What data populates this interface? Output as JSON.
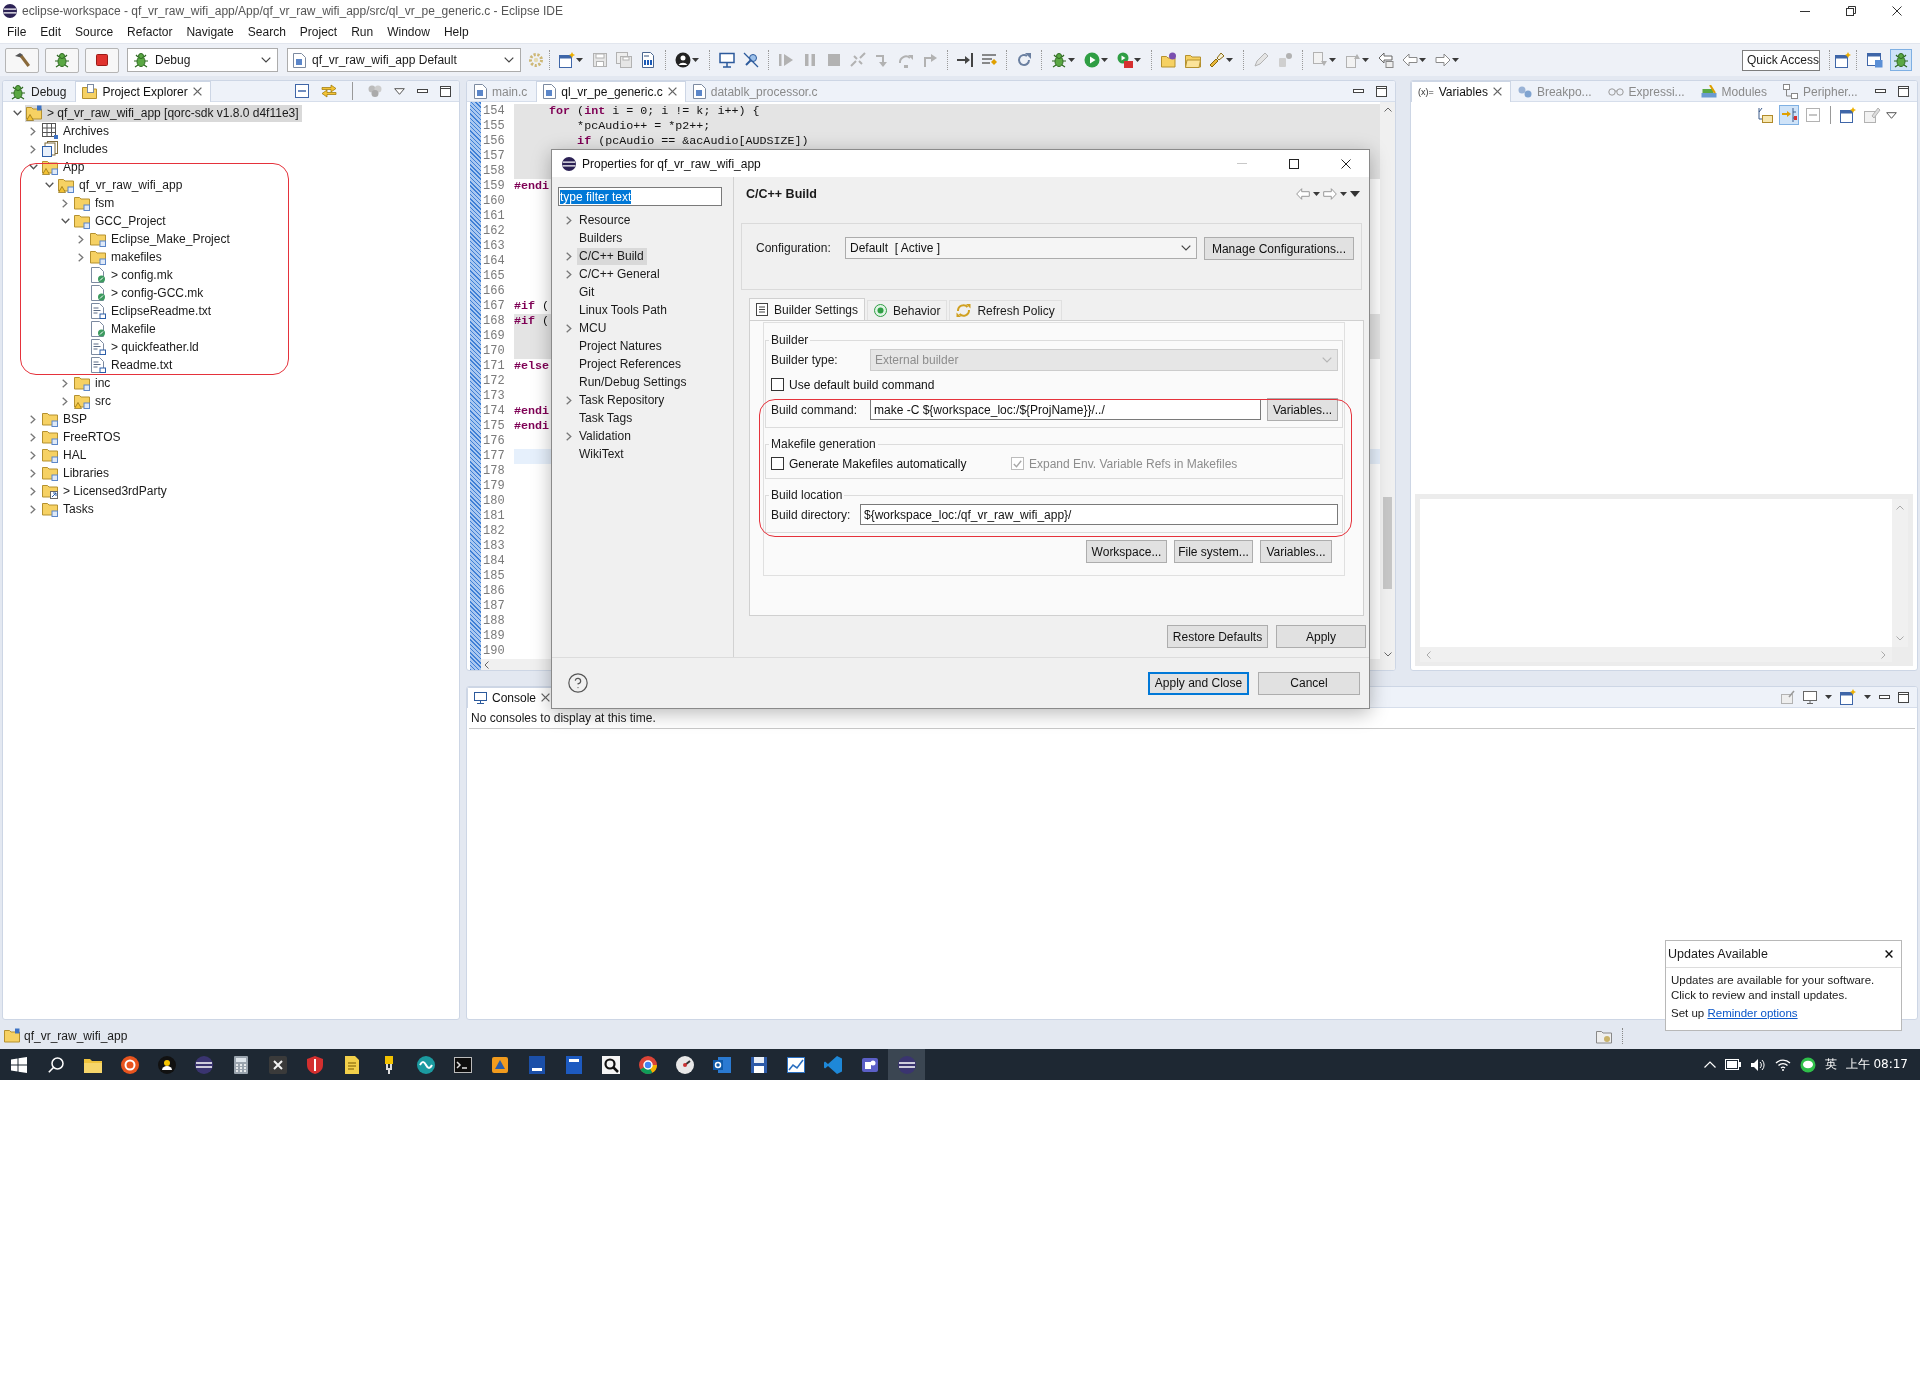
{
  "window": {
    "title": "eclipse-workspace - qf_vr_raw_wifi_app/App/qf_vr_raw_wifi_app/src/ql_vr_pe_generic.c - Eclipse IDE"
  },
  "menu": [
    "File",
    "Edit",
    "Source",
    "Refactor",
    "Navigate",
    "Search",
    "Project",
    "Run",
    "Window",
    "Help"
  ],
  "toolbar": {
    "launch_mode": "Debug",
    "launch_configuration": "qf_vr_raw_wifi_app Default",
    "quick_access": {
      "placeholder": "Quick Access"
    },
    "perspectives": [
      {
        "selected": false
      },
      {
        "selected": true
      }
    ]
  },
  "project_explorer": {
    "tabs": [
      {
        "label": "Debug",
        "selected": false
      },
      {
        "label": "Project Explorer",
        "selected": true
      }
    ],
    "tree": [
      {
        "label": "> qf_vr_raw_wifi_app [qorc-sdk v1.8.0 d4f11e3]",
        "kind": "project",
        "expanded": true,
        "selected": true,
        "children": [
          {
            "label": "Archives",
            "kind": "archives",
            "expanded": false,
            "selected": false
          },
          {
            "label": "Includes",
            "kind": "includes",
            "expanded": false,
            "selected": false
          },
          {
            "label": "App",
            "kind": "warning_folder",
            "expanded": true,
            "selected": false,
            "children": [
              {
                "label": "qf_vr_raw_wifi_app",
                "kind": "warning_folder",
                "expanded": true,
                "selected": false,
                "children": [
                  {
                    "label": "fsm",
                    "kind": "folder",
                    "expanded": false,
                    "selected": false
                  },
                  {
                    "label": "GCC_Project",
                    "kind": "folder",
                    "expanded": true,
                    "selected": false,
                    "children": [
                      {
                        "label": "Eclipse_Make_Project",
                        "kind": "folder",
                        "expanded": false,
                        "selected": false
                      },
                      {
                        "label": "makefiles",
                        "kind": "folder",
                        "expanded": false,
                        "selected": false
                      },
                      {
                        "label": "> config.mk",
                        "kind": "file",
                        "selected": false
                      },
                      {
                        "label": "> config-GCC.mk",
                        "kind": "file",
                        "selected": false
                      },
                      {
                        "label": "EclipseReadme.txt",
                        "kind": "text_file",
                        "selected": false
                      },
                      {
                        "label": "Makefile",
                        "kind": "file",
                        "selected": false
                      },
                      {
                        "label": "> quickfeather.ld",
                        "kind": "text_file",
                        "selected": false
                      },
                      {
                        "label": "Readme.txt",
                        "kind": "text_file",
                        "selected": false
                      }
                    ]
                  },
                  {
                    "label": "inc",
                    "kind": "folder",
                    "expanded": false,
                    "selected": false
                  },
                  {
                    "label": "src",
                    "kind": "warning_folder",
                    "expanded": false,
                    "selected": false
                  }
                ]
              }
            ]
          },
          {
            "label": "BSP",
            "kind": "folder",
            "expanded": false,
            "selected": false
          },
          {
            "label": "FreeRTOS",
            "kind": "folder",
            "expanded": false,
            "selected": false
          },
          {
            "label": "HAL",
            "kind": "folder",
            "expanded": false,
            "selected": false
          },
          {
            "label": "Libraries",
            "kind": "folder",
            "expanded": false,
            "selected": false
          },
          {
            "label": "> Licensed3rdParty",
            "kind": "linked_folder",
            "expanded": false,
            "selected": false
          },
          {
            "label": "Tasks",
            "kind": "folder",
            "expanded": false,
            "selected": false
          }
        ]
      }
    ]
  },
  "editor": {
    "tabs": [
      {
        "label": "main.c",
        "selected": false
      },
      {
        "label": "ql_vr_pe_generic.c",
        "selected": true
      },
      {
        "label": "datablk_processor.c",
        "selected": false
      }
    ],
    "lines": [
      {
        "number": "154",
        "kind": "inactive",
        "tokens": [
          {
            "text": "     for",
            "kind": "keyword"
          },
          {
            "text": " (",
            "kind": "plain"
          },
          {
            "text": "int",
            "kind": "keyword"
          },
          {
            "text": " i = 0; i != k; i++) {",
            "kind": "plain"
          }
        ]
      },
      {
        "number": "155",
        "kind": "inactive",
        "tokens": [
          {
            "text": "         *pcAudio++ = *p2++;",
            "kind": "plain"
          }
        ]
      },
      {
        "number": "156",
        "kind": "inactive",
        "tokens": [
          {
            "text": "         if",
            "kind": "keyword"
          },
          {
            "text": " (pcAudio == &acAudio[AUDSIZE])",
            "kind": "plain"
          }
        ]
      },
      {
        "number": "157",
        "kind": "inactive"
      },
      {
        "number": "158",
        "kind": "inactive"
      },
      {
        "number": "159",
        "kind": "plain",
        "tokens": [
          {
            "text": "#endi",
            "kind": "keyword"
          }
        ]
      },
      {
        "number": "160",
        "kind": "plain"
      },
      {
        "number": "161",
        "kind": "plain"
      },
      {
        "number": "162",
        "kind": "plain"
      },
      {
        "number": "163",
        "kind": "plain"
      },
      {
        "number": "164",
        "kind": "plain"
      },
      {
        "number": "165",
        "kind": "plain"
      },
      {
        "number": "166",
        "kind": "plain"
      },
      {
        "number": "167",
        "kind": "plain",
        "tokens": [
          {
            "text": "#if",
            "kind": "keyword"
          },
          {
            "text": " (",
            "kind": "plain"
          }
        ]
      },
      {
        "number": "168",
        "kind": "inactive",
        "tokens": [
          {
            "text": "#if",
            "kind": "keyword"
          },
          {
            "text": " (",
            "kind": "plain"
          }
        ]
      },
      {
        "number": "169",
        "kind": "inactive"
      },
      {
        "number": "170",
        "kind": "inactive"
      },
      {
        "number": "171",
        "kind": "plain",
        "tokens": [
          {
            "text": "#else",
            "kind": "keyword"
          }
        ]
      },
      {
        "number": "172",
        "kind": "plain"
      },
      {
        "number": "173",
        "kind": "plain"
      },
      {
        "number": "174",
        "kind": "plain",
        "tokens": [
          {
            "text": "#endi",
            "kind": "keyword"
          }
        ]
      },
      {
        "number": "175",
        "kind": "plain",
        "tokens": [
          {
            "text": "#endi",
            "kind": "keyword"
          }
        ]
      },
      {
        "number": "176",
        "kind": "plain"
      },
      {
        "number": "177",
        "kind": "current"
      },
      {
        "number": "178",
        "kind": "plain"
      },
      {
        "number": "179",
        "kind": "plain"
      },
      {
        "number": "180",
        "kind": "plain"
      },
      {
        "number": "181",
        "kind": "plain"
      },
      {
        "number": "182",
        "kind": "plain"
      },
      {
        "number": "183",
        "kind": "plain"
      },
      {
        "number": "184",
        "kind": "plain"
      },
      {
        "number": "185",
        "kind": "plain"
      },
      {
        "number": "186",
        "kind": "plain"
      },
      {
        "number": "187",
        "kind": "plain"
      },
      {
        "number": "188",
        "kind": "plain"
      },
      {
        "number": "189",
        "kind": "plain"
      },
      {
        "number": "190",
        "kind": "plain"
      }
    ]
  },
  "debug_views": {
    "tabs": [
      {
        "glyph": "(x)=",
        "label": "Variables",
        "selected": true
      },
      {
        "label": "Breakpo...",
        "selected": false
      },
      {
        "label": "Expressi...",
        "selected": false
      },
      {
        "label": "Modules",
        "selected": false
      },
      {
        "label": "Peripher...",
        "selected": false
      }
    ],
    "toolbar": [
      {
        "on": false
      },
      {
        "on": true
      },
      {
        "on": false
      },
      {
        "on": false
      },
      {
        "on": false
      }
    ]
  },
  "console": {
    "tabs": [
      {
        "label": "Console",
        "selected": true
      }
    ],
    "message": "No consoles to display at this time."
  },
  "status_bar": {
    "selection": "qf_vr_raw_wifi_app"
  },
  "dialog": {
    "title": "Properties for qf_vr_raw_wifi_app",
    "filter": {
      "value": "type filter text",
      "text_selected": true
    },
    "pages": [
      {
        "label": "Resource",
        "expanded": false,
        "selected": false
      },
      {
        "label": "Builders",
        "selected": false
      },
      {
        "label": "C/C++ Build",
        "expanded": false,
        "selected": true
      },
      {
        "label": "C/C++ General",
        "expanded": false,
        "selected": false
      },
      {
        "label": "Git",
        "selected": false
      },
      {
        "label": "Linux Tools Path",
        "selected": false
      },
      {
        "label": "MCU",
        "expanded": false,
        "selected": false
      },
      {
        "label": "Project Natures",
        "selected": false
      },
      {
        "label": "Project References",
        "selected": false
      },
      {
        "label": "Run/Debug Settings",
        "selected": false
      },
      {
        "label": "Task Repository",
        "expanded": false,
        "selected": false
      },
      {
        "label": "Task Tags",
        "selected": false
      },
      {
        "label": "Validation",
        "expanded": false,
        "selected": false
      },
      {
        "label": "WikiText",
        "selected": false
      }
    ],
    "page_title": "C/C++ Build",
    "configuration": {
      "label": "Configuration:",
      "value": "Default  [ Active ]",
      "button": "Manage Configurations..."
    },
    "tabs": [
      {
        "label": "Builder Settings",
        "selected": true
      },
      {
        "label": "Behavior",
        "selected": false
      },
      {
        "label": "Refresh Policy",
        "selected": false
      }
    ],
    "builder": {
      "title": "Builder",
      "type_label": "Builder type:",
      "type_value": "External builder",
      "type_disabled": true,
      "use_default": {
        "label": "Use default build command",
        "checked": false
      },
      "command_label": "Build command:",
      "command_value": "make -C ${workspace_loc:/${ProjName}}/../",
      "command_button": "Variables..."
    },
    "makefile_generation": {
      "title": "Makefile generation",
      "options": [
        {
          "label": "Generate Makefiles automatically",
          "checked": false,
          "disabled": false
        },
        {
          "label": "Expand Env. Variable Refs in Makefiles",
          "checked": true,
          "disabled": true
        }
      ]
    },
    "build_location": {
      "title": "Build location",
      "directory_label": "Build directory:",
      "directory_value": "${workspace_loc:/qf_vr_raw_wifi_app}/",
      "buttons": [
        "Workspace...",
        "File system...",
        "Variables..."
      ]
    },
    "page_buttons": [
      "Restore Defaults",
      "Apply"
    ],
    "buttons": [
      {
        "label": "Apply and Close",
        "default": true
      },
      {
        "label": "Cancel",
        "default": false
      }
    ]
  },
  "updates_popup": {
    "title": "Updates Available",
    "lines": [
      "Updates are available for your software.",
      "Click to review and install updates."
    ],
    "setup_prefix": "Set up",
    "link": "Reminder options"
  },
  "taskbar": {
    "apps": [
      {
        "selected": false
      },
      {
        "selected": false
      },
      {
        "selected": false
      },
      {
        "selected": false
      },
      {
        "selected": false
      },
      {
        "selected": false
      },
      {
        "selected": false
      },
      {
        "selected": false
      },
      {
        "selected": false
      },
      {
        "selected": false
      },
      {
        "selected": false
      },
      {
        "selected": false
      },
      {
        "selected": false
      },
      {
        "selected": false
      },
      {
        "selected": false
      },
      {
        "selected": false
      },
      {
        "selected": false
      },
      {
        "selected": false
      },
      {
        "selected": false
      },
      {
        "selected": false
      },
      {
        "selected": false
      },
      {
        "selected": false
      },
      {
        "selected": true
      }
    ],
    "ime": "英",
    "clock": "上午 08:17"
  }
}
